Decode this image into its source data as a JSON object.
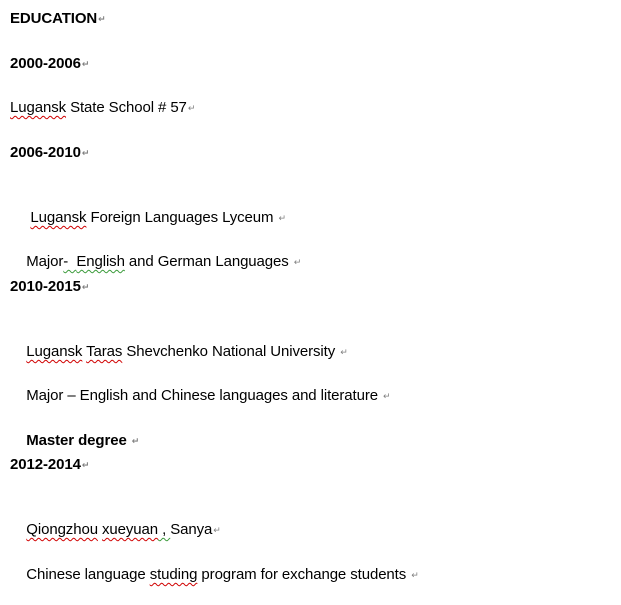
{
  "document": {
    "paragraph_mark": "↵",
    "paragraphs": [
      {
        "id": "education-heading",
        "bold": true,
        "segments": [
          {
            "text": "EDUCATION"
          }
        ]
      },
      {
        "id": "period-2000-2006",
        "bold": true,
        "segments": [
          {
            "text": "2000-2006"
          }
        ]
      },
      {
        "id": "school-57",
        "bold": false,
        "segments": [
          {
            "text": "Lugansk",
            "squiggle": "spelling"
          },
          {
            "text": " State School # 57"
          }
        ]
      },
      {
        "id": "period-2006-2010",
        "bold": true,
        "segments": [
          {
            "text": "2006-2010"
          }
        ]
      },
      {
        "id": "foreign-languages-lyceum",
        "bold": false,
        "segments": [
          {
            "text": " "
          },
          {
            "text": "Lugansk",
            "squiggle": "spelling"
          },
          {
            "text": " Foreign Languages Lyceum "
          }
        ]
      },
      {
        "id": "major-english-german",
        "bold": false,
        "segments": [
          {
            "text": "Major"
          },
          {
            "text": "-  ",
            "squiggle": "grammar"
          },
          {
            "text": "English",
            "squiggle": "grammar"
          },
          {
            "text": " and German Languages "
          }
        ]
      },
      {
        "id": "period-2010-2015",
        "bold": true,
        "segments": [
          {
            "text": "2010-2015"
          }
        ]
      },
      {
        "id": "national-university",
        "bold": false,
        "segments": [
          {
            "text": "Lugansk",
            "squiggle": "spelling"
          },
          {
            "text": " "
          },
          {
            "text": "Taras",
            "squiggle": "spelling"
          },
          {
            "text": " Shevchenko National University "
          }
        ]
      },
      {
        "id": "major-english-chinese",
        "bold": false,
        "segments": [
          {
            "text": "Major – English and Chinese languages and literature "
          }
        ]
      },
      {
        "id": "master-degree",
        "bold": true,
        "segments": [
          {
            "text": "Master degree "
          }
        ]
      },
      {
        "id": "period-2012-2014",
        "bold": true,
        "segments": [
          {
            "text": "2012-2014"
          }
        ]
      },
      {
        "id": "qiongzhou-xueyuan",
        "bold": false,
        "segments": [
          {
            "text": "Qiongzhou",
            "squiggle": "spelling"
          },
          {
            "text": " "
          },
          {
            "text": "xueyuan",
            "squiggle": "spelling"
          },
          {
            "text": " , ",
            "squiggle": "grammar"
          },
          {
            "text": "Sanya"
          }
        ]
      },
      {
        "id": "exchange-program",
        "bold": false,
        "segments": [
          {
            "text": "Chinese language "
          },
          {
            "text": "studing",
            "squiggle": "spelling"
          },
          {
            "text": " program for exchange students "
          }
        ]
      }
    ]
  }
}
